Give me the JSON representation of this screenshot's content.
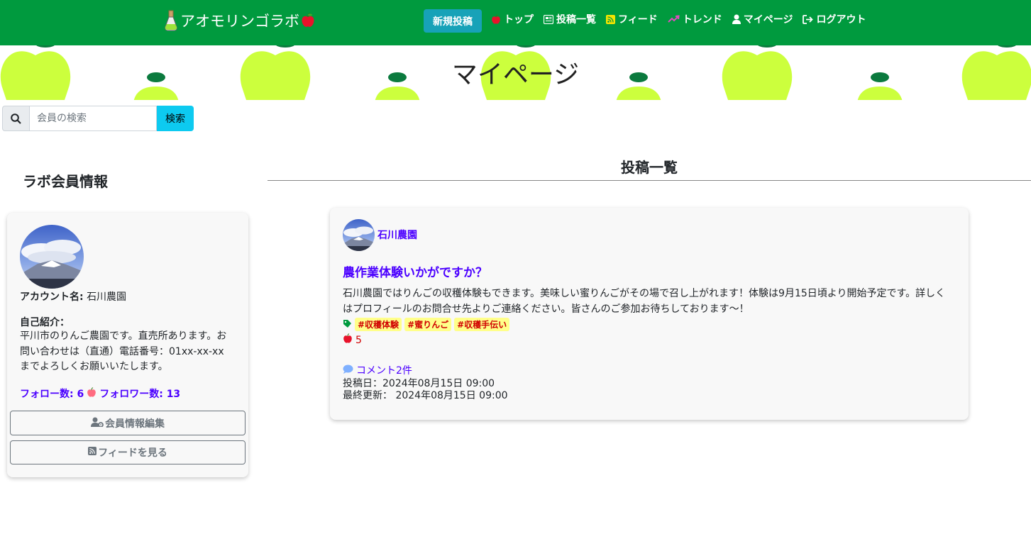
{
  "nav": {
    "brand": "アオモリンゴラボ",
    "new_post": "新規投稿",
    "links": [
      {
        "label": "トップ",
        "icon": "apple-icon"
      },
      {
        "label": "投稿一覧",
        "icon": "list-icon"
      },
      {
        "label": "フィード",
        "icon": "rss-icon"
      },
      {
        "label": "トレンド",
        "icon": "trend-icon"
      },
      {
        "label": "マイページ",
        "icon": "user-icon"
      },
      {
        "label": "ログアウト",
        "icon": "logout-icon"
      }
    ]
  },
  "banner": {
    "title": "マイページ"
  },
  "search": {
    "placeholder": "会員の検索",
    "button": "検索"
  },
  "profile": {
    "section_title": "ラボ会員情報",
    "account_label": "アカウント名:",
    "account_name": "石川農園",
    "intro_label": "自己紹介：",
    "intro_text": "平川市のりんご農園です。直売所あります。お問い合わせは（直通）電話番号：01xx-xx-xx までよろしくお願いいたします。",
    "follow_label": "フォロー数: 6",
    "follower_label": "フォロワー数: 13",
    "edit_button": "会員情報編集",
    "feed_button": "フィードを見る"
  },
  "main": {
    "title": "投稿一覧",
    "post": {
      "author": "石川農園",
      "title": "農作業体験いかがですか？",
      "body": "石川農園ではりんごの収穫体験もできます。美味しい蜜りんごがその場で召し上がれます！体験は9月15日頃より開始予定です。詳しくはプロフィールのお問合せ先よりご連絡ください。皆さんのご参加お待ちしております〜！",
      "tags": [
        "#収穫体験",
        "#蜜りんご",
        "#収穫手伝い"
      ],
      "likes": "5",
      "comments": "コメント2件",
      "posted": "投稿日：2024年08月15日 09:00",
      "updated": "最終更新： 2024年08月15日 09:00"
    }
  },
  "colors": {
    "navbar": "#009a3e",
    "accent_link": "#4b00ff",
    "apple_green": "#ccff3d",
    "tag_bg": "#ffff8a",
    "search_button": "#0dcaf0"
  }
}
